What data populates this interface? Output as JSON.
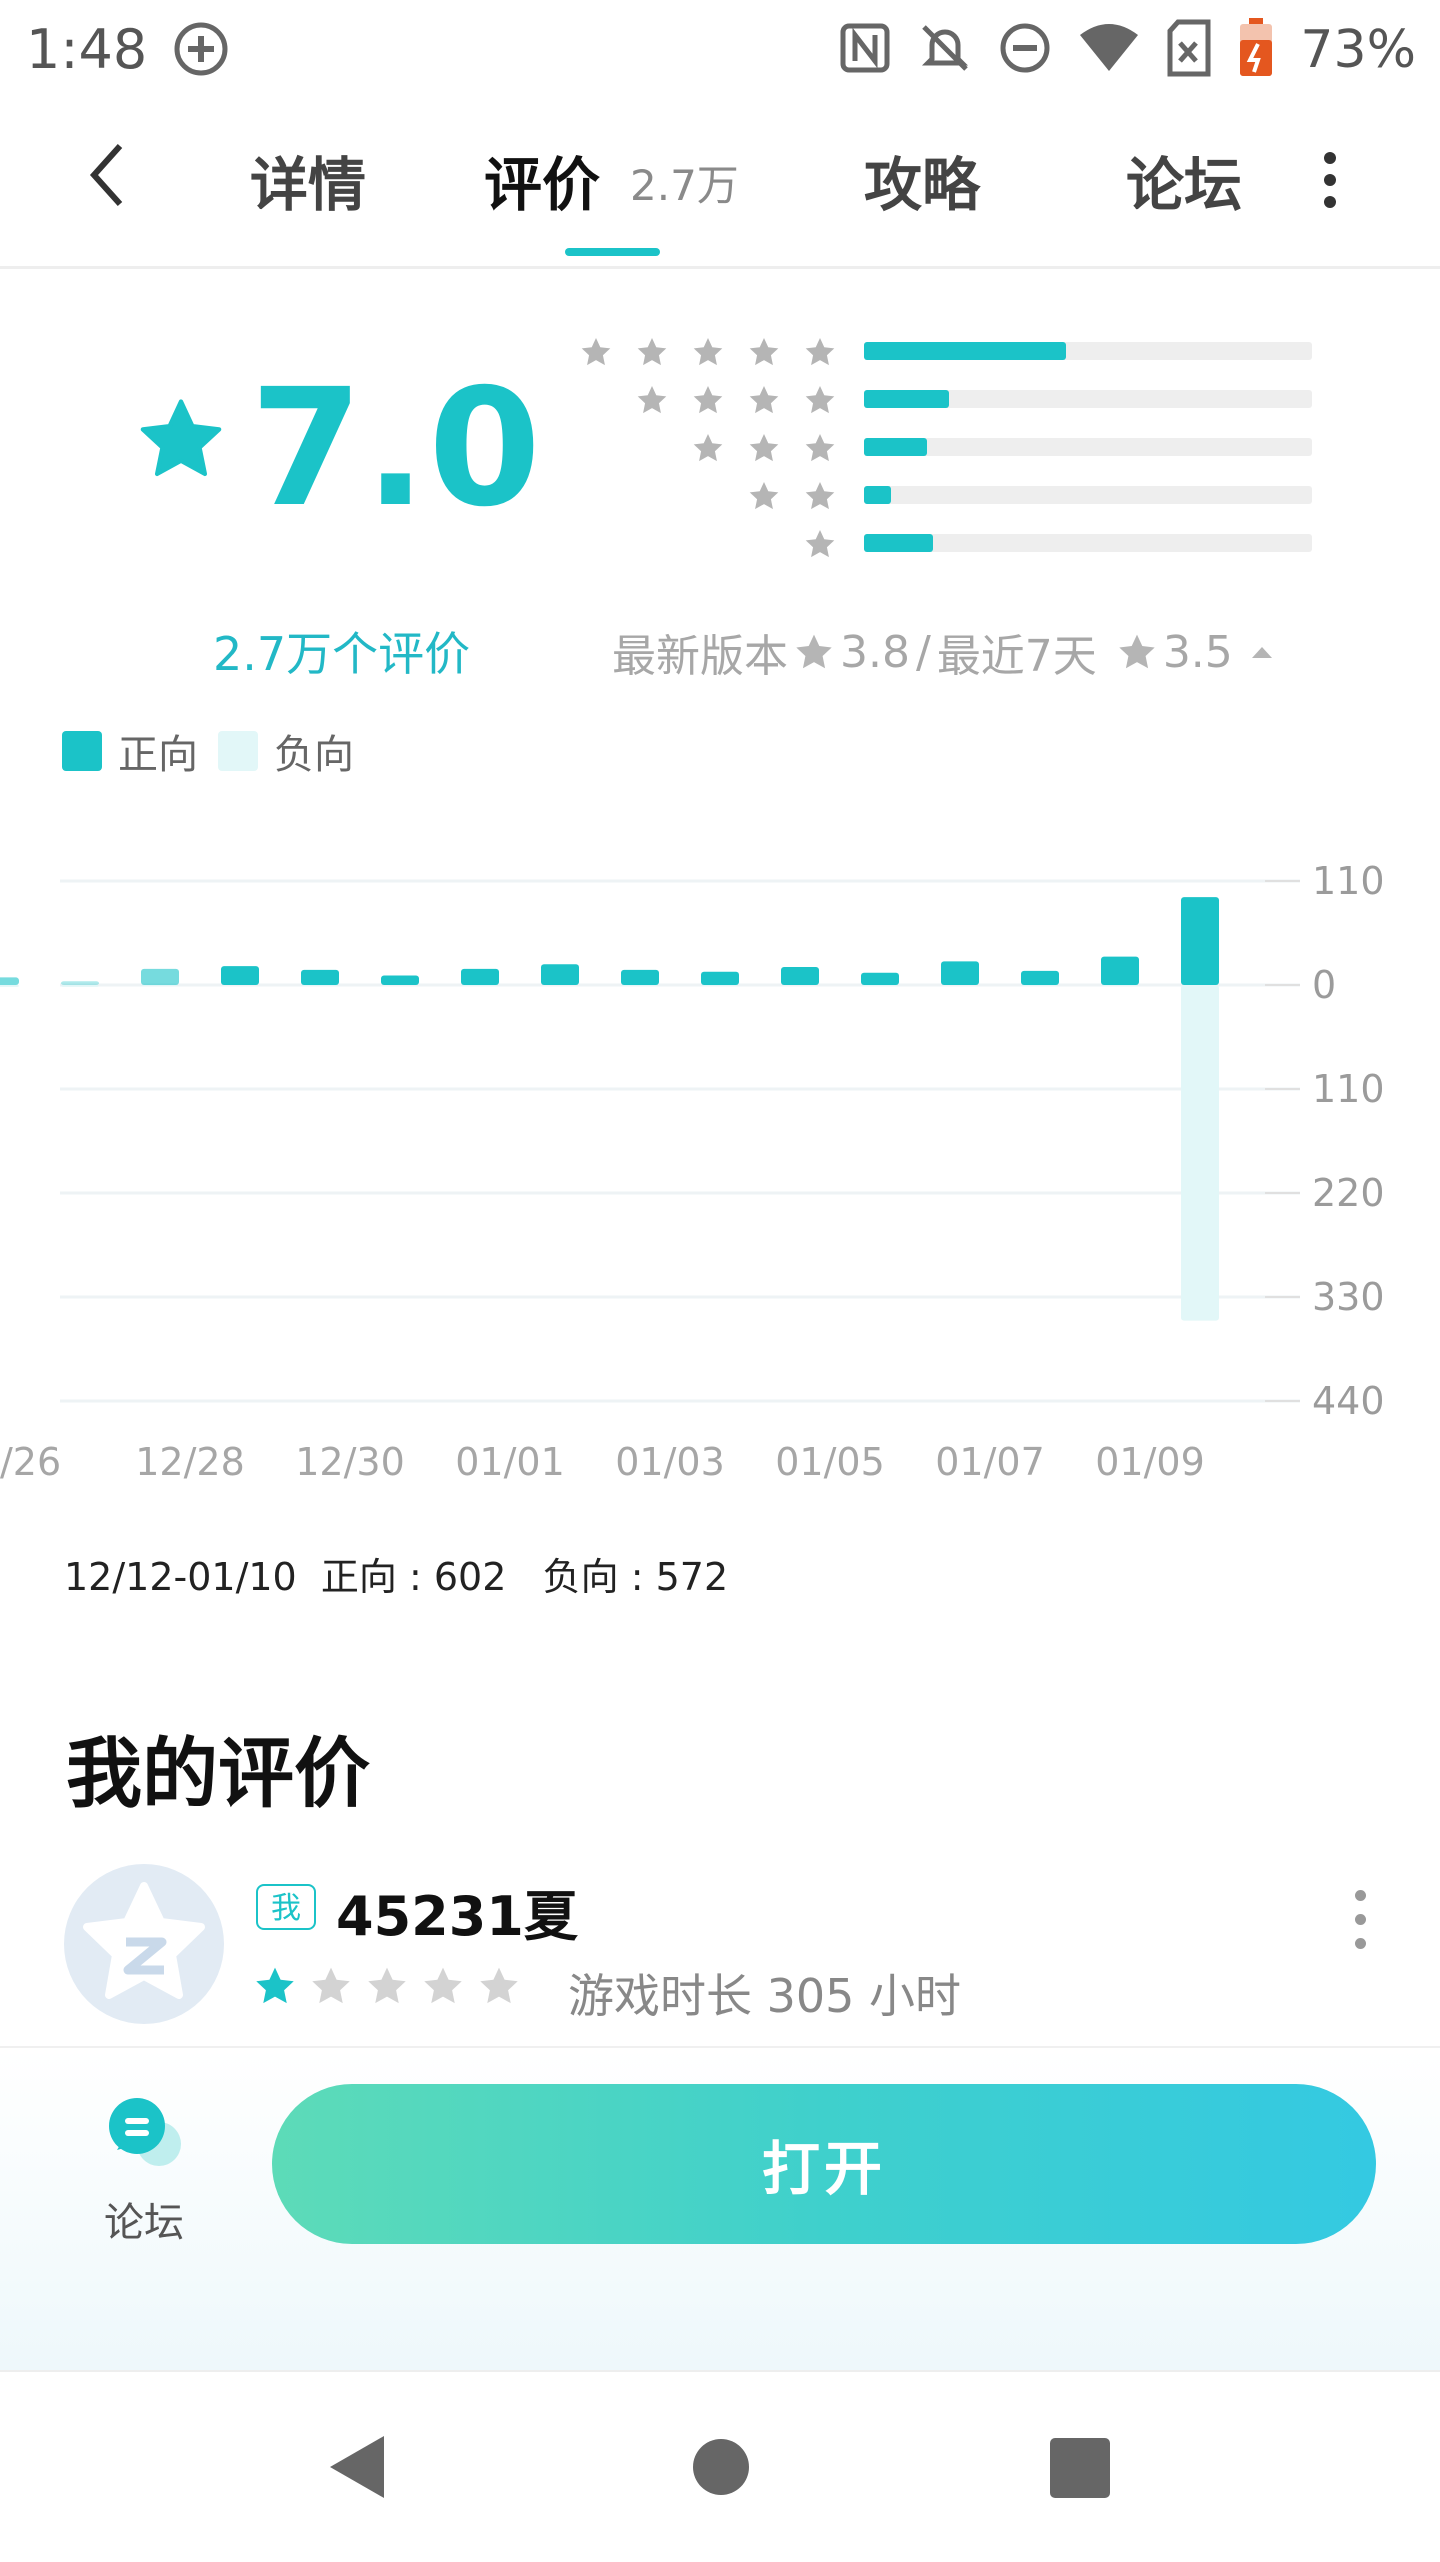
{
  "status_bar": {
    "time": "1:48",
    "battery": "73%",
    "icons": [
      "location-plus-icon",
      "nfc-icon",
      "notifications-off-icon",
      "do-not-disturb-icon",
      "wifi-icon",
      "sim-icon",
      "battery-charging-icon"
    ]
  },
  "header": {
    "back_icon": "chevron-left-icon",
    "tabs": [
      {
        "label": "详情"
      },
      {
        "label": "评价",
        "count": "2.7万",
        "active": true
      },
      {
        "label": "攻略"
      },
      {
        "label": "论坛"
      }
    ],
    "more_icon": "more-vertical-icon",
    "accent_color": "#1bc3c8"
  },
  "rating": {
    "score": "7.0",
    "total_label": "2.7万个评价",
    "distribution": [
      {
        "stars": 5,
        "fraction": 0.45
      },
      {
        "stars": 4,
        "fraction": 0.19
      },
      {
        "stars": 3,
        "fraction": 0.14
      },
      {
        "stars": 2,
        "fraction": 0.06
      },
      {
        "stars": 1,
        "fraction": 0.155
      }
    ],
    "latest_version_label": "最新版本",
    "latest_version_score": "3.8",
    "separator": "/",
    "recent_label": "最近7天",
    "recent_score": "3.5",
    "toggle_icon": "caret-up-icon"
  },
  "legend": {
    "positive_label": "正向",
    "negative_label": "负向",
    "positive_color": "#1bc3c8",
    "negative_color": "#e2f7f8"
  },
  "chart_data": {
    "type": "bar",
    "categories": [
      "12/25",
      "12/26",
      "12/27",
      "12/28",
      "12/29",
      "12/30",
      "12/31",
      "01/01",
      "01/02",
      "01/03",
      "01/04",
      "01/05",
      "01/06",
      "01/07",
      "01/08",
      "01/09",
      "01/10"
    ],
    "x_tick_labels": [
      "/26",
      "12/28",
      "12/30",
      "01/01",
      "01/03",
      "01/05",
      "01/07",
      "01/09"
    ],
    "series": [
      {
        "name": "正向",
        "values": [
          8,
          4,
          17,
          20,
          16,
          10,
          17,
          22,
          16,
          14,
          19,
          13,
          25,
          15,
          30,
          93
        ]
      },
      {
        "name": "负向",
        "values": [
          2,
          2,
          1,
          0,
          1,
          0,
          1,
          0,
          1,
          1,
          0,
          1,
          0,
          1,
          1,
          355
        ]
      }
    ],
    "y_tick_labels": [
      "110",
      "0",
      "110",
      "220",
      "330",
      "440"
    ],
    "ylim": [
      -440,
      110
    ],
    "grid": true
  },
  "chart_summary": {
    "range": "12/12-01/10",
    "positive": "正向 : 602",
    "negative": "负向 : 572"
  },
  "my_review": {
    "title": "我的评价",
    "badge": "我",
    "username": "45231夏",
    "stars": 1,
    "max_stars": 5,
    "play_time": "游戏时长 305 小时",
    "more_icon": "more-vertical-icon"
  },
  "bottom": {
    "forum_label": "论坛",
    "open_label": "打开"
  },
  "nav": {
    "back_icon": "nav-back-icon",
    "home_icon": "nav-home-icon",
    "recents_icon": "nav-recents-icon"
  }
}
